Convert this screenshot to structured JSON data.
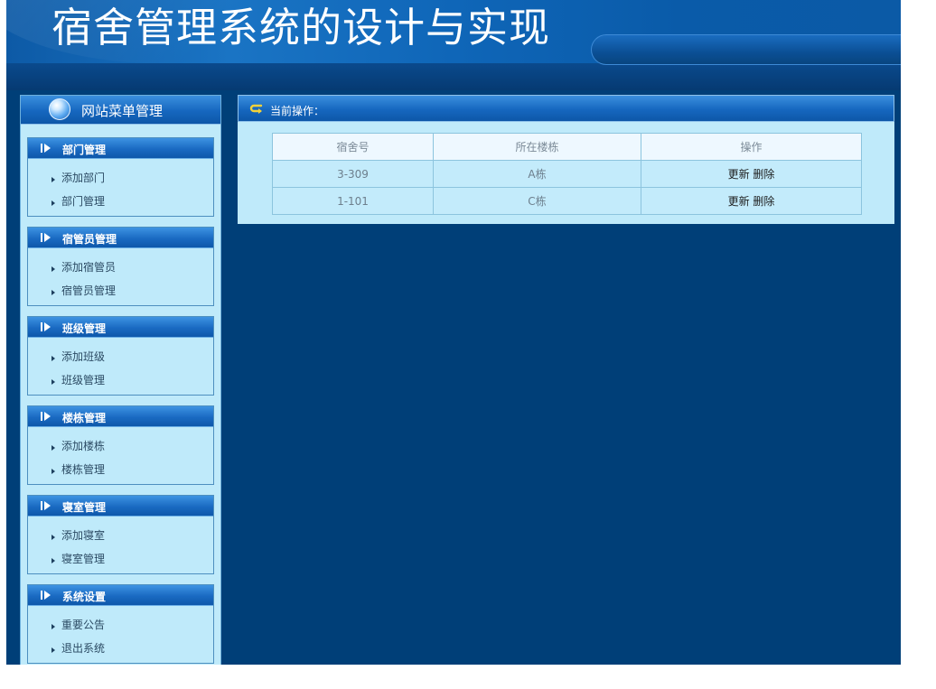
{
  "header": {
    "title": "宿舍管理系统的设计与实现"
  },
  "sidebar": {
    "title": "网站菜单管理",
    "groups": [
      {
        "title": "部门管理",
        "items": [
          "添加部门",
          "部门管理"
        ]
      },
      {
        "title": "宿管员管理",
        "items": [
          "添加宿管员",
          "宿管员管理"
        ]
      },
      {
        "title": "班级管理",
        "items": [
          "添加班级",
          "班级管理"
        ]
      },
      {
        "title": "楼栋管理",
        "items": [
          "添加楼栋",
          "楼栋管理"
        ]
      },
      {
        "title": "寝室管理",
        "items": [
          "添加寝室",
          "寝室管理"
        ]
      },
      {
        "title": "系统设置",
        "items": [
          "重要公告",
          "退出系统"
        ]
      }
    ]
  },
  "main": {
    "current_op_label": "当前操作：",
    "table": {
      "headers": [
        "宿舍号",
        "所在楼栋",
        "操作"
      ],
      "rows": [
        {
          "room": "3-309",
          "building": "A栋",
          "update": "更新",
          "delete": "删除"
        },
        {
          "room": "1-101",
          "building": "C栋",
          "update": "更新",
          "delete": "删除"
        }
      ]
    }
  },
  "colors": {
    "page_bg": "#003f78",
    "panel_bg": "#bfeafa",
    "header_blue": "#1667bf"
  }
}
